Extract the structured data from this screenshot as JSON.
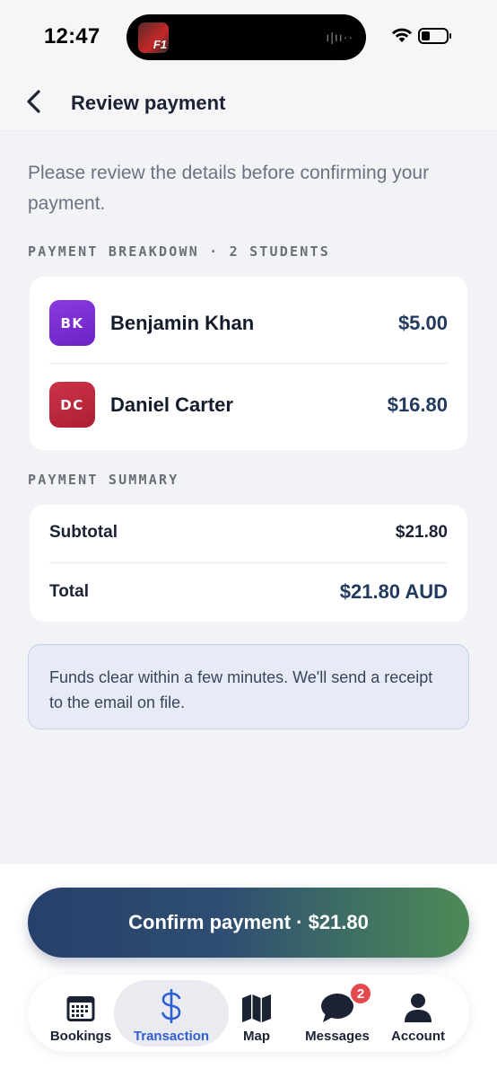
{
  "status_bar": {
    "time": "12:47",
    "island_thumb_text": "F1",
    "island_wave": "ı|ıı··"
  },
  "header": {
    "title": "Review payment",
    "back_icon": "chevron-left-icon"
  },
  "intro_text": "Please review the details before confirming your payment.",
  "breakdown": {
    "label": "PAYMENT BREAKDOWN · 2 STUDENTS",
    "students": [
      {
        "initials": "BK",
        "name": "Benjamin Khan",
        "amount": "$5.00",
        "color": "#7b2fd6"
      },
      {
        "initials": "DC",
        "name": "Daniel Carter",
        "amount": "$16.80",
        "color": "#c0283d"
      }
    ]
  },
  "summary": {
    "label": "PAYMENT SUMMARY",
    "subtotal_label": "Subtotal",
    "subtotal_value": "$21.80",
    "total_label": "Total",
    "total_value": "$21.80 AUD"
  },
  "notice_text": "Funds clear within a few minutes. We'll send a receipt to the email on file.",
  "confirm_button": "Confirm payment · $21.80",
  "tabs": [
    {
      "label": "Bookings",
      "icon": "calendar-icon",
      "active": false
    },
    {
      "label": "Transaction",
      "icon": "dollar-icon",
      "active": true
    },
    {
      "label": "Map",
      "icon": "map-icon",
      "active": false
    },
    {
      "label": "Messages",
      "icon": "chat-bubble-icon",
      "active": false,
      "badge": "2"
    },
    {
      "label": "Account",
      "icon": "person-icon",
      "active": false
    }
  ],
  "colors": {
    "accent": "#2f5fd0",
    "amount": "#223a5e",
    "badge": "#e5484d"
  }
}
